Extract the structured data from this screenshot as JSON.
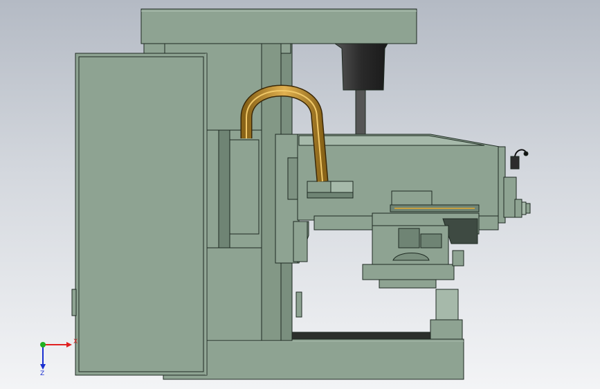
{
  "app": {
    "view": "side-view",
    "display_mode": "shaded-with-edges"
  },
  "model": {
    "parts": [
      "top-cover",
      "left-door-panel",
      "column",
      "spindle-housing",
      "drawbar",
      "cable-carrier",
      "headstock",
      "crank-handle",
      "handwheel",
      "cross-slide",
      "saddle",
      "knee-bracket",
      "base"
    ]
  },
  "triad": {
    "x_label": "X",
    "z_label": "Z",
    "colors": {
      "x": "#e02020",
      "y": "#20b020",
      "z": "#1a2fd0"
    }
  },
  "colors": {
    "body": "#8ea392",
    "body_light": "#a6b9aa",
    "body_dark": "#6f8474",
    "cable": "#c89a3a",
    "dark_part": "#2a2a2a",
    "background_top": "#b4bac4",
    "background_bottom": "#f3f4f6"
  }
}
